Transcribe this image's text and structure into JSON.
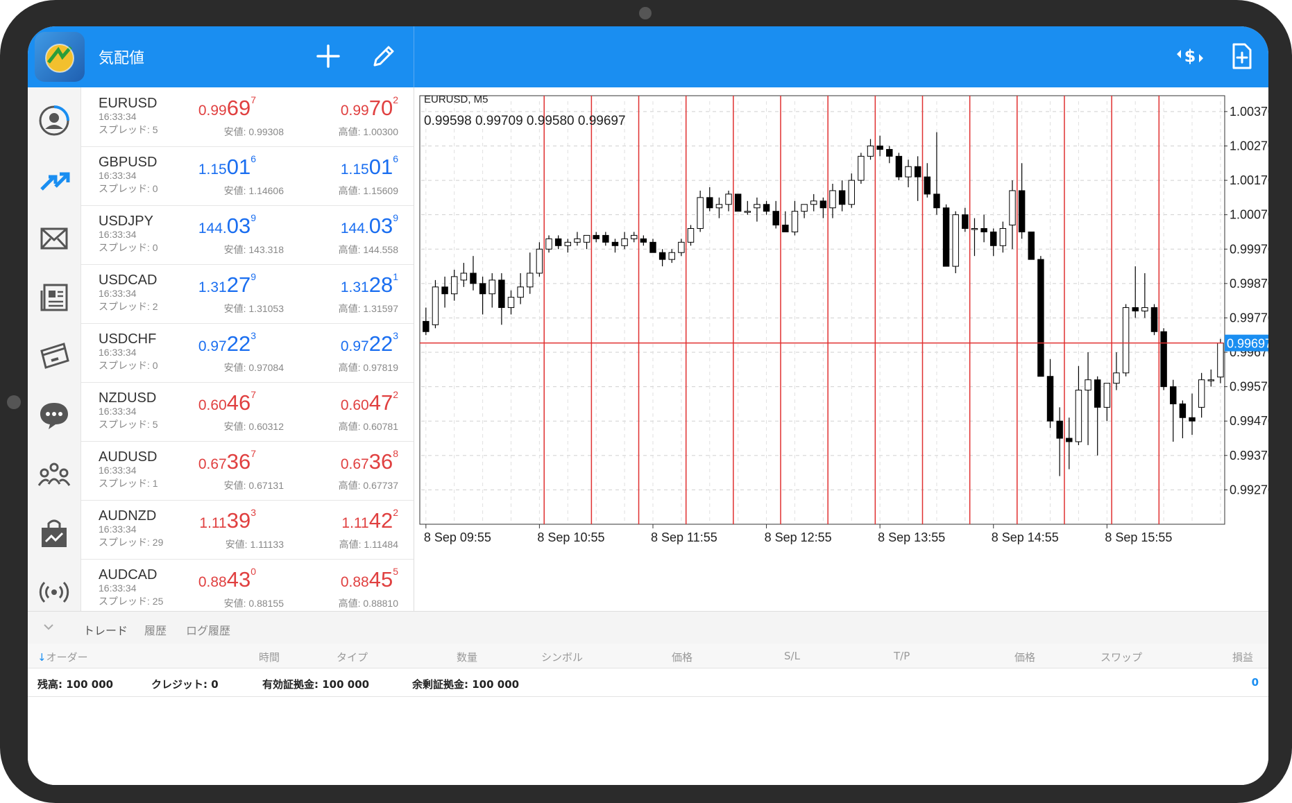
{
  "app": {
    "title": "気配値"
  },
  "quotes": [
    {
      "symbol": "EURUSD",
      "time": "16:33:34",
      "spread": "スプレッド: 5",
      "color": "red",
      "bid": {
        "small": "0.99",
        "big": "69",
        "sup": "7"
      },
      "ask": {
        "small": "0.99",
        "big": "70",
        "sup": "2"
      },
      "low": "安値: 0.99308",
      "high": "高値: 1.00300"
    },
    {
      "symbol": "GBPUSD",
      "time": "16:33:34",
      "spread": "スプレッド: 0",
      "color": "blue",
      "bid": {
        "small": "1.15",
        "big": "01",
        "sup": "6"
      },
      "ask": {
        "small": "1.15",
        "big": "01",
        "sup": "6"
      },
      "low": "安値: 1.14606",
      "high": "高値: 1.15609"
    },
    {
      "symbol": "USDJPY",
      "time": "16:33:34",
      "spread": "スプレッド: 0",
      "color": "blue",
      "bid": {
        "small": "144.",
        "big": "03",
        "sup": "9"
      },
      "ask": {
        "small": "144.",
        "big": "03",
        "sup": "9"
      },
      "low": "安値: 143.318",
      "high": "高値: 144.558"
    },
    {
      "symbol": "USDCAD",
      "time": "16:33:34",
      "spread": "スプレッド: 2",
      "color": "blue",
      "bid": {
        "small": "1.31",
        "big": "27",
        "sup": "9"
      },
      "ask": {
        "small": "1.31",
        "big": "28",
        "sup": "1"
      },
      "low": "安値: 1.31053",
      "high": "高値: 1.31597"
    },
    {
      "symbol": "USDCHF",
      "time": "16:33:34",
      "spread": "スプレッド: 0",
      "color": "blue",
      "bid": {
        "small": "0.97",
        "big": "22",
        "sup": "3"
      },
      "ask": {
        "small": "0.97",
        "big": "22",
        "sup": "3"
      },
      "low": "安値: 0.97084",
      "high": "高値: 0.97819"
    },
    {
      "symbol": "NZDUSD",
      "time": "16:33:34",
      "spread": "スプレッド: 5",
      "color": "red",
      "bid": {
        "small": "0.60",
        "big": "46",
        "sup": "7"
      },
      "ask": {
        "small": "0.60",
        "big": "47",
        "sup": "2"
      },
      "low": "安値: 0.60312",
      "high": "高値: 0.60781"
    },
    {
      "symbol": "AUDUSD",
      "time": "16:33:34",
      "spread": "スプレッド: 1",
      "color": "red",
      "bid": {
        "small": "0.67",
        "big": "36",
        "sup": "7"
      },
      "ask": {
        "small": "0.67",
        "big": "36",
        "sup": "8"
      },
      "low": "安値: 0.67131",
      "high": "高値: 0.67737"
    },
    {
      "symbol": "AUDNZD",
      "time": "16:33:34",
      "spread": "スプレッド: 29",
      "color": "red",
      "bid": {
        "small": "1.11",
        "big": "39",
        "sup": "3"
      },
      "ask": {
        "small": "1.11",
        "big": "42",
        "sup": "2"
      },
      "low": "安値: 1.11133",
      "high": "高値: 1.11484"
    },
    {
      "symbol": "AUDCAD",
      "time": "16:33:34",
      "spread": "スプレッド: 25",
      "color": "red",
      "bid": {
        "small": "0.88",
        "big": "43",
        "sup": "0"
      },
      "ask": {
        "small": "0.88",
        "big": "45",
        "sup": "5"
      },
      "low": "安値: 0.88155",
      "high": "高値: 0.88810"
    }
  ],
  "chart": {
    "symbol_label": "EURUSD, M5",
    "ohlc_label": "0.99598 0.99709 0.99580 0.99697",
    "current_price": "0.99697"
  },
  "chart_data": {
    "type": "candlestick",
    "title": "EURUSD, M5",
    "ohlc_text": "0.99598 0.99709 0.99580 0.99697",
    "y_ticks": [
      1.0037,
      1.0027,
      1.0017,
      1.0007,
      0.9997,
      0.9987,
      0.9977,
      0.9967,
      0.9957,
      0.9947,
      0.9937,
      0.9927
    ],
    "y_tick_labels": [
      "1.00370",
      "1.00270",
      "1.00170",
      "1.00070",
      "0.99970",
      "0.99870",
      "0.99770",
      "0.99670",
      "0.99570",
      "0.99470",
      "0.99370",
      "0.99270"
    ],
    "ylim": [
      0.9917,
      1.004
    ],
    "x_tick_labels": [
      "8 Sep 09:55",
      "8 Sep 10:55",
      "8 Sep 11:55",
      "8 Sep 12:55",
      "8 Sep 13:55",
      "8 Sep 14:55",
      "8 Sep 15:55"
    ],
    "x_tick_candle_index": [
      0,
      12,
      24,
      36,
      48,
      60,
      72
    ],
    "vertical_markers_candle_index": [
      13,
      18,
      23,
      28,
      33,
      38,
      43,
      48,
      53,
      58,
      63,
      68,
      73,
      78
    ],
    "current_price": 0.99697,
    "current_price_label": "0.99697",
    "colors": {
      "up": "#ffffff",
      "down": "#000000",
      "marker": "#e03030",
      "price_label_bg": "#1a8ef1"
    },
    "candles": [
      [
        0.9976,
        0.998,
        0.9972,
        0.9973
      ],
      [
        0.9975,
        0.9988,
        0.9974,
        0.9986
      ],
      [
        0.9986,
        0.9989,
        0.998,
        0.9984
      ],
      [
        0.9984,
        0.9991,
        0.9982,
        0.9989
      ],
      [
        0.9988,
        0.9993,
        0.9986,
        0.999
      ],
      [
        0.999,
        0.9995,
        0.9985,
        0.9987
      ],
      [
        0.9987,
        0.9989,
        0.9978,
        0.9984
      ],
      [
        0.9984,
        0.999,
        0.998,
        0.9988
      ],
      [
        0.9988,
        0.999,
        0.9975,
        0.998
      ],
      [
        0.998,
        0.9985,
        0.9978,
        0.9983
      ],
      [
        0.9983,
        0.999,
        0.9981,
        0.9986
      ],
      [
        0.9986,
        0.9996,
        0.9984,
        0.999
      ],
      [
        0.999,
        0.9999,
        0.9989,
        0.9997
      ],
      [
        0.9997,
        1.0001,
        0.9996,
        1.0
      ],
      [
        1.0,
        1.0001,
        0.9997,
        0.9998
      ],
      [
        0.9998,
        1.0,
        0.9996,
        0.9999
      ],
      [
        0.9999,
        1.0002,
        0.9998,
        1.0
      ],
      [
        0.9999,
        1.0001,
        0.9997,
        1.0001
      ],
      [
        1.0001,
        1.0002,
        0.9999,
        1.0
      ],
      [
        1.0001,
        1.0002,
        0.9998,
        0.9999
      ],
      [
        0.9999,
        1.0,
        0.9996,
        0.9998
      ],
      [
        0.9998,
        1.0002,
        0.9997,
        1.0
      ],
      [
        1.0,
        1.0002,
        0.9999,
        1.0001
      ],
      [
        1.0,
        1.0001,
        0.9998,
        0.9999
      ],
      [
        0.9999,
        1.0,
        0.9996,
        0.9996
      ],
      [
        0.9996,
        0.9997,
        0.9992,
        0.9994
      ],
      [
        0.9994,
        0.9997,
        0.9993,
        0.9996
      ],
      [
        0.9996,
        1.0,
        0.9995,
        0.9999
      ],
      [
        0.9999,
        1.0004,
        0.9998,
        1.0003
      ],
      [
        1.0003,
        1.0014,
        1.0002,
        1.0012
      ],
      [
        1.0012,
        1.0015,
        1.0008,
        1.0009
      ],
      [
        1.0009,
        1.0012,
        1.0006,
        1.001
      ],
      [
        1.001,
        1.0014,
        1.0008,
        1.0013
      ],
      [
        1.0013,
        1.0013,
        1.0008,
        1.0008
      ],
      [
        1.0008,
        1.0011,
        1.0007,
        1.0008
      ],
      [
        1.0009,
        1.0012,
        1.0005,
        1.001
      ],
      [
        1.001,
        1.0011,
        1.0007,
        1.0008
      ],
      [
        1.0008,
        1.0011,
        1.0003,
        1.0004
      ],
      [
        1.0004,
        1.0008,
        1.0002,
        1.0002
      ],
      [
        1.0002,
        1.0011,
        1.0001,
        1.0008
      ],
      [
        1.0008,
        1.001,
        1.0006,
        1.001
      ],
      [
        1.001,
        1.0013,
        1.0008,
        1.0011
      ],
      [
        1.0011,
        1.0012,
        1.0006,
        1.0009
      ],
      [
        1.0009,
        1.0016,
        1.0006,
        1.0014
      ],
      [
        1.0014,
        1.0017,
        1.0008,
        1.001
      ],
      [
        1.001,
        1.0019,
        1.0009,
        1.0017
      ],
      [
        1.0017,
        1.0025,
        1.0016,
        1.0024
      ],
      [
        1.0024,
        1.0029,
        1.0023,
        1.0027
      ],
      [
        1.0027,
        1.003,
        1.0024,
        1.0026
      ],
      [
        1.0026,
        1.0027,
        1.0022,
        1.0024
      ],
      [
        1.0024,
        1.0025,
        1.0017,
        1.0018
      ],
      [
        1.0018,
        1.0023,
        1.0015,
        1.0021
      ],
      [
        1.0021,
        1.0024,
        1.0011,
        1.0018
      ],
      [
        1.0018,
        1.0022,
        1.0012,
        1.0013
      ],
      [
        1.0013,
        1.0031,
        1.0007,
        1.0009
      ],
      [
        1.0009,
        1.001,
        0.9992,
        0.9992
      ],
      [
        0.9992,
        1.0008,
        0.999,
        1.0007
      ],
      [
        1.0007,
        1.0009,
        1.0002,
        1.0003
      ],
      [
        1.0003,
        1.0006,
        0.9995,
        1.0003
      ],
      [
        1.0003,
        1.0007,
        0.9999,
        1.0002
      ],
      [
        1.0002,
        1.0003,
        0.9995,
        0.9998
      ],
      [
        0.9998,
        1.0005,
        0.9996,
        1.0003
      ],
      [
        1.0004,
        1.0017,
        0.9997,
        1.0014
      ],
      [
        1.0014,
        1.0022,
        1.0,
        1.0002
      ],
      [
        1.0002,
        1.0002,
        0.9997,
        0.9994
      ],
      [
        0.9994,
        0.9995,
        0.996,
        0.996
      ],
      [
        0.996,
        0.9965,
        0.9945,
        0.9947
      ],
      [
        0.9947,
        0.9951,
        0.9931,
        0.9942
      ],
      [
        0.9942,
        0.9948,
        0.9933,
        0.9941
      ],
      [
        0.9941,
        0.9963,
        0.994,
        0.9956
      ],
      [
        0.9956,
        0.9967,
        0.994,
        0.9959
      ],
      [
        0.9959,
        0.996,
        0.9937,
        0.9951
      ],
      [
        0.9951,
        0.9955,
        0.9947,
        0.9958
      ],
      [
        0.9958,
        0.9967,
        0.9956,
        0.9961
      ],
      [
        0.9961,
        0.9981,
        0.996,
        0.998
      ],
      [
        0.998,
        0.9992,
        0.9977,
        0.9979
      ],
      [
        0.9979,
        0.999,
        0.9977,
        0.998
      ],
      [
        0.998,
        0.9981,
        0.9972,
        0.9973
      ],
      [
        0.9973,
        0.9974,
        0.9956,
        0.9957
      ],
      [
        0.9957,
        0.9959,
        0.9941,
        0.9952
      ],
      [
        0.9952,
        0.9953,
        0.9942,
        0.9948
      ],
      [
        0.9948,
        0.9955,
        0.9943,
        0.9947
      ],
      [
        0.9951,
        0.9961,
        0.9948,
        0.9959
      ],
      [
        0.9959,
        0.9962,
        0.9957,
        0.9959
      ],
      [
        0.99598,
        0.99709,
        0.9958,
        0.99697
      ]
    ]
  },
  "bottom": {
    "tabs": [
      "トレード",
      "履歴",
      "ログ履歴"
    ],
    "columns": [
      "オーダー",
      "時間",
      "タイプ",
      "数量",
      "シンボル",
      "価格",
      "S/L",
      "T/P",
      "価格",
      "スワップ",
      "損益"
    ],
    "balance": {
      "balance_label": "残高:",
      "balance_value": "100 000",
      "credit_label": "クレジット:",
      "credit_value": "0",
      "equity_label": "有効証拠金:",
      "equity_value": "100 000",
      "free_margin_label": "余剰証拠金:",
      "free_margin_value": "100 000",
      "pl_value": "0"
    }
  }
}
